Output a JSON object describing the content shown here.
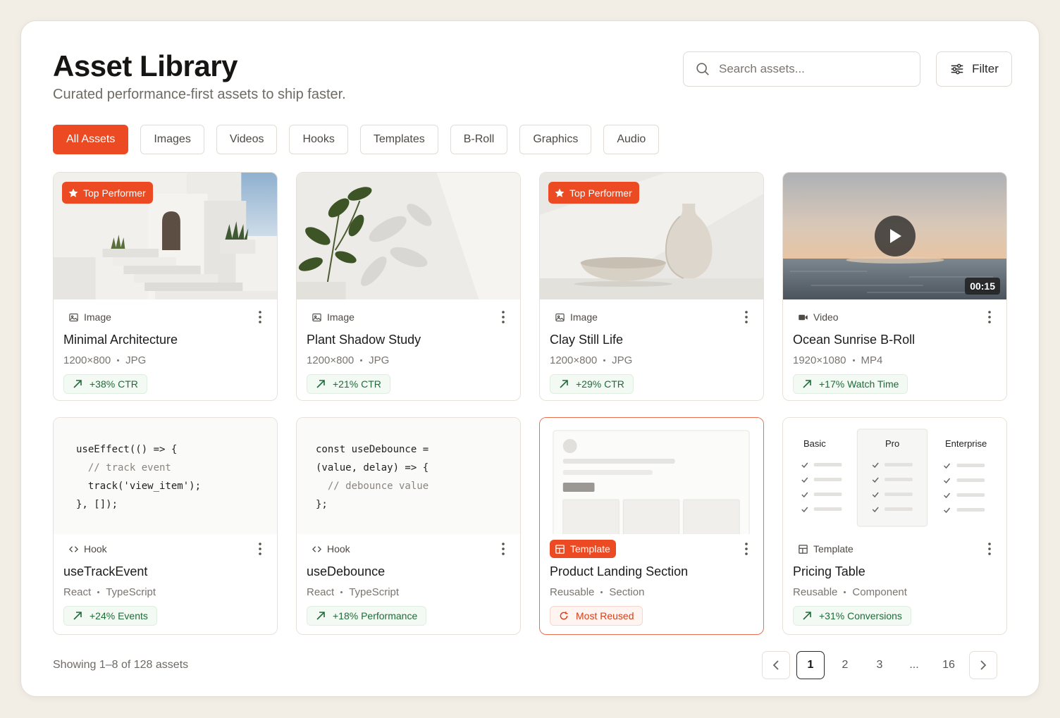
{
  "header": {
    "title": "Asset Library",
    "subtitle": "Curated performance-first assets to ship faster.",
    "search_placeholder": "Search assets...",
    "filter_label": "Filter"
  },
  "tabs": [
    "All Assets",
    "Images",
    "Videos",
    "Hooks",
    "Templates",
    "B-Roll",
    "Graphics",
    "Audio"
  ],
  "active_tab": "All Assets",
  "assets": [
    {
      "type": "Image",
      "name": "Minimal Architecture",
      "spec1": "1200×800",
      "spec2": "JPG",
      "stat": "+38% CTR",
      "badge": "Top Performer"
    },
    {
      "type": "Image",
      "name": "Plant Shadow Study",
      "spec1": "1200×800",
      "spec2": "JPG",
      "stat": "+21% CTR"
    },
    {
      "type": "Image",
      "name": "Clay Still Life",
      "spec1": "1200×800",
      "spec2": "JPG",
      "stat": "+29% CTR",
      "badge": "Top Performer"
    },
    {
      "type": "Video",
      "name": "Ocean Sunrise B-Roll",
      "spec1": "1920×1080",
      "spec2": "MP4",
      "stat": "+17% Watch Time",
      "duration": "00:15"
    },
    {
      "type": "Hook",
      "name": "useTrackEvent",
      "spec1": "React",
      "spec2": "TypeScript",
      "stat": "+24% Events",
      "code": [
        "useEffect(() => {",
        "  // track event",
        "  track('view_item');",
        "}, []);"
      ]
    },
    {
      "type": "Hook",
      "name": "useDebounce",
      "spec1": "React",
      "spec2": "TypeScript",
      "stat": "+18% Performance",
      "code": [
        "const useDebounce =",
        "(value, delay) => {",
        "  // debounce value",
        "};"
      ]
    },
    {
      "type": "Template",
      "name": "Product Landing Section",
      "spec1": "Reusable",
      "spec2": "Section",
      "stat": "Most Reused"
    },
    {
      "type": "Template",
      "name": "Pricing Table",
      "spec1": "Reusable",
      "spec2": "Component",
      "stat": "+31% Conversions",
      "pricing_cols": [
        "Basic",
        "Pro",
        "Enterprise"
      ]
    }
  ],
  "footer": {
    "showing": "Showing 1–8 of 128 assets",
    "pages": [
      "1",
      "2",
      "3",
      "...",
      "16"
    ],
    "current_page": "1"
  },
  "colors": {
    "accent": "#ec4a22",
    "positive": "#1f6b38"
  }
}
